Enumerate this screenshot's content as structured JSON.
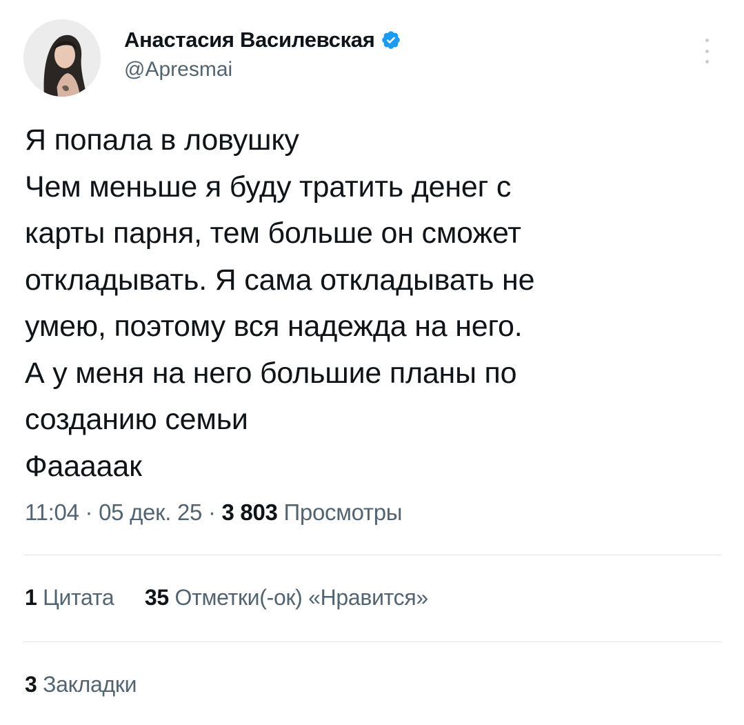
{
  "author": {
    "display_name": "Анастасия Василевская",
    "handle": "@Apresmai",
    "verified": true,
    "verified_color": "#1d9bf0"
  },
  "tweet": {
    "lines": [
      "Я попала в ловушку",
      "Чем меньше я буду тратить денег с",
      "карты парня, тем больше он сможет",
      "откладывать. Я сама откладывать не",
      "умею, поэтому вся надежда на него.",
      "А у меня на него большие планы по",
      "созданию семьи",
      "Фааааак"
    ]
  },
  "meta": {
    "time": "11:04",
    "separator": "·",
    "date": "05 дек. 25",
    "views_count": "3 803",
    "views_label": "Просмотры"
  },
  "stats": {
    "quotes_count": "1",
    "quotes_label": "Цитата",
    "likes_count": "35",
    "likes_label": "Отметки(-ок) «Нравится»",
    "bookmarks_count": "3",
    "bookmarks_label": "Закладки"
  },
  "icons": {
    "more": "more-vertical-icon",
    "verified": "verified-badge-icon"
  }
}
